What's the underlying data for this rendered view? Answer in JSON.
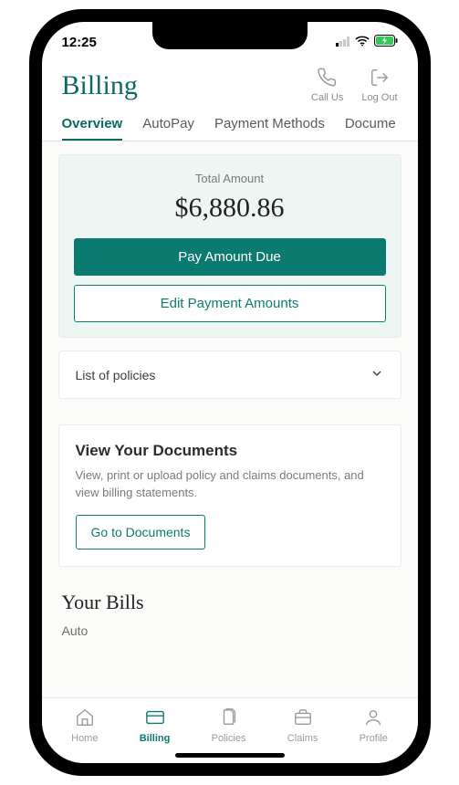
{
  "status": {
    "time": "12:25"
  },
  "header": {
    "title": "Billing",
    "actions": {
      "call": "Call Us",
      "logout": "Log Out"
    }
  },
  "tabs": [
    "Overview",
    "AutoPay",
    "Payment Methods",
    "Docume"
  ],
  "total": {
    "label": "Total Amount",
    "amount": "$6,880.86",
    "pay_btn": "Pay Amount Due",
    "edit_btn": "Edit Payment Amounts"
  },
  "policies_row": "List of policies",
  "documents": {
    "title": "View Your Documents",
    "desc": "View, print or upload policy and claims documents, and view billing statements.",
    "btn": "Go to Documents"
  },
  "your_bills": {
    "title": "Your Bills",
    "sub": "Auto"
  },
  "nav": {
    "home": "Home",
    "billing": "Billing",
    "policies": "Policies",
    "claims": "Claims",
    "profile": "Profile"
  }
}
